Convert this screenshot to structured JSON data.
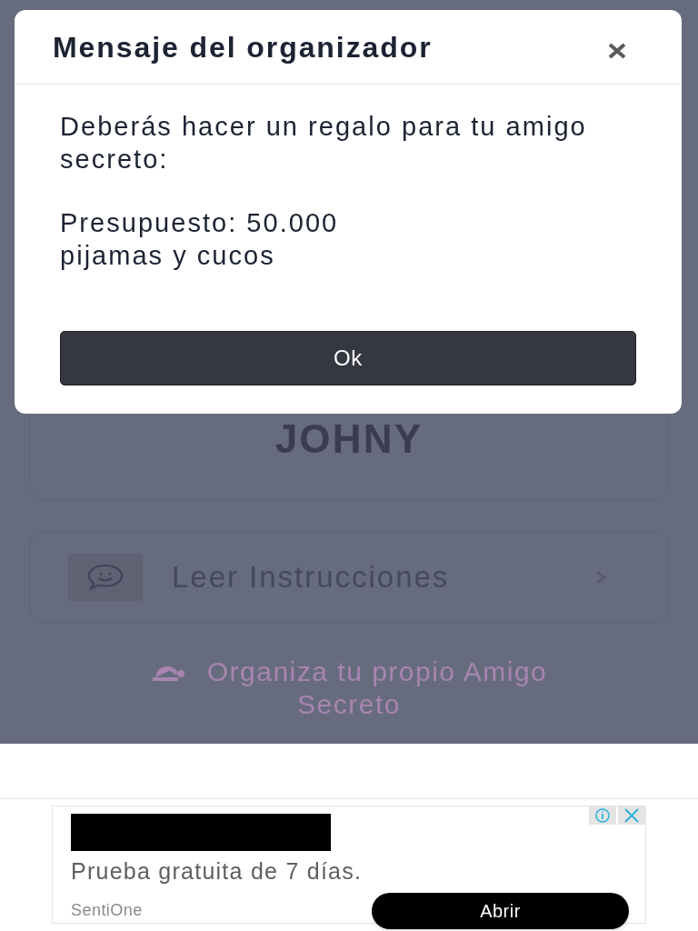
{
  "modal": {
    "title": "Mensaje del organizador",
    "paragraphs": [
      "Deberás hacer un regalo para tu amigo secreto:",
      "Presupuesto: 50.000\npijamas y cucos"
    ],
    "button": "Ok"
  },
  "background": {
    "name": "JOHNY",
    "instructions": "Leer Instrucciones",
    "link": "Organiza tu propio Amigo Secreto"
  },
  "ad": {
    "text": "Prueba gratuita de 7 días.",
    "advertiser": "SentiOne",
    "button": "Abrir"
  }
}
